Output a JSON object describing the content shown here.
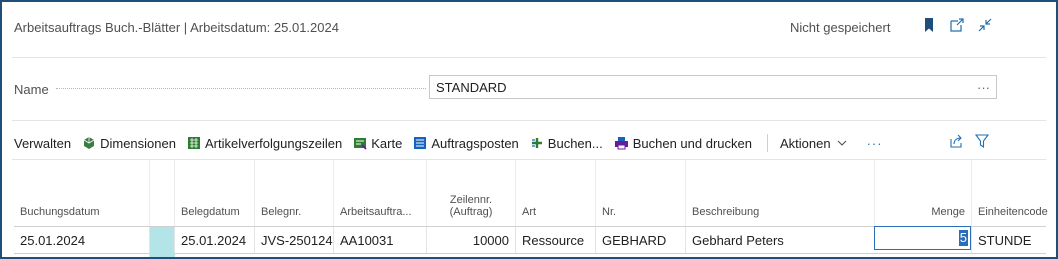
{
  "header": {
    "title": "Arbeitsauftrags Buch.-Blätter | Arbeitsdatum: 25.01.2024",
    "status": "Nicht gespeichert",
    "icons": [
      "bookmark-icon",
      "open-new-window-icon",
      "collapse-icon"
    ],
    "accent": "#1f4e79"
  },
  "name_field": {
    "label": "Name",
    "value": "STANDARD",
    "more": "···"
  },
  "actions": {
    "items": [
      {
        "label": "Verwalten",
        "icon": ""
      },
      {
        "label": "Dimensionen",
        "icon": "dimensions-icon"
      },
      {
        "label": "Artikelverfolgungszeilen",
        "icon": "item-tracking-icon"
      },
      {
        "label": "Karte",
        "icon": "card-icon"
      },
      {
        "label": "Auftragsposten",
        "icon": "entries-icon"
      },
      {
        "label": "Buchen...",
        "icon": "post-icon"
      },
      {
        "label": "Buchen und drucken",
        "icon": "post-print-icon"
      }
    ],
    "aktionen": "Aktionen",
    "more": "···",
    "share_icon": "share-icon",
    "filter_icon": "filter-icon"
  },
  "grid": {
    "columns": {
      "buchungsdatum": "Buchungsdatum",
      "belegdatum": "Belegdatum",
      "belegnr": "Belegnr.",
      "arbeitsauftrag": "Arbeitsauftra...",
      "zeilennr_1": "Zeilennr.",
      "zeilennr_2": "(Auftrag)",
      "art": "Art",
      "nr": "Nr.",
      "beschreibung": "Beschreibung",
      "menge": "Menge",
      "einheitencode": "Einheitencode"
    },
    "row": {
      "buchungsdatum": "25.01.2024",
      "belegdatum": "25.01.2024",
      "belegnr": "JVS-250124",
      "arbeitsauftrag": "AA10031",
      "zeilennr": "10000",
      "art": "Ressource",
      "nr": "GEBHARD",
      "beschreibung": "Gebhard Peters",
      "menge": "5",
      "einheitencode": "STUNDE"
    },
    "selection_color": "#b3e5e8"
  }
}
